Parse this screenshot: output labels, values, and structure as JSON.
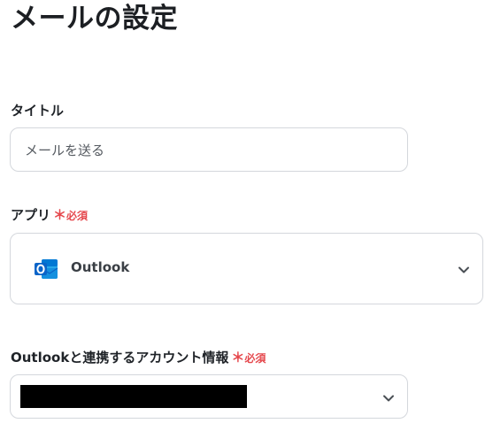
{
  "page": {
    "title": "メールの設定"
  },
  "title_field": {
    "label": "タイトル",
    "value": "メールを送る"
  },
  "app_field": {
    "label": "アプリ",
    "required_mark": "＊",
    "required_text": "必須",
    "selected_app": "Outlook",
    "icon": "outlook-icon"
  },
  "account_field": {
    "label": "Outlookと連携するアカウント情報",
    "required_mark": "＊",
    "required_text": "必須",
    "value_redacted": true
  },
  "colors": {
    "required": "#e5484d",
    "border": "#d4d7dc",
    "outlook_blue": "#0a64c8"
  }
}
